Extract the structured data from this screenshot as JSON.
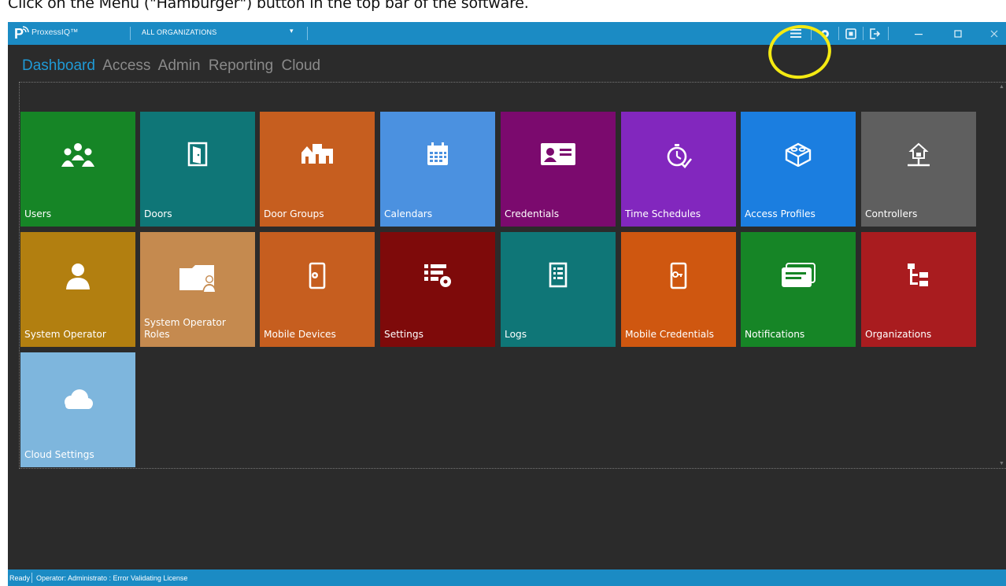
{
  "instruction": "Click on the Menu (\"Hamburger\") button in the top bar of the software.",
  "titlebar": {
    "app_name": "ProxessIQ™",
    "organization": "ALL ORGANIZATIONS",
    "buttons": [
      "hamburger-menu-icon",
      "gear-icon",
      "app-icon",
      "logout-icon",
      "minimize-icon",
      "maximize-icon",
      "close-icon"
    ]
  },
  "nav": {
    "tabs": [
      "Dashboard",
      "Access",
      "Admin",
      "Reporting",
      "Cloud"
    ],
    "active": "Dashboard"
  },
  "tiles": [
    {
      "label": "Users",
      "color": "#168526",
      "icon": "users-icon"
    },
    {
      "label": "Doors",
      "color": "#0f7677",
      "icon": "door-icon"
    },
    {
      "label": "Door Groups",
      "color": "#c65e1f",
      "icon": "door-groups-icon"
    },
    {
      "label": "Calendars",
      "color": "#4b91e0",
      "icon": "calendar-icon"
    },
    {
      "label": "Credentials",
      "color": "#7b0a6e",
      "icon": "id-card-icon"
    },
    {
      "label": "Time Schedules",
      "color": "#8227be",
      "icon": "stopwatch-icon"
    },
    {
      "label": "Access Profiles",
      "color": "#1b7ee0",
      "icon": "lego-brick-icon"
    },
    {
      "label": "Controllers",
      "color": "#5f5f5f",
      "icon": "network-home-icon"
    },
    {
      "label": "System Operator",
      "color": "#b27f10",
      "icon": "person-icon"
    },
    {
      "label": "System Operator Roles",
      "color": "#c58a4f",
      "icon": "folder-person-icon"
    },
    {
      "label": "Mobile Devices",
      "color": "#c65e1f",
      "icon": "mobile-gear-icon"
    },
    {
      "label": "Settings",
      "color": "#7e0a0a",
      "icon": "settings-list-icon"
    },
    {
      "label": "Logs",
      "color": "#0f7677",
      "icon": "log-list-icon"
    },
    {
      "label": "Mobile Credentials",
      "color": "#cf5710",
      "icon": "mobile-key-icon"
    },
    {
      "label": "Notifications",
      "color": "#168526",
      "icon": "notification-message-icon"
    },
    {
      "label": "Organizations",
      "color": "#a91c1f",
      "icon": "org-tree-icon"
    },
    {
      "label": "Cloud Settings",
      "color": "#7eb6dd",
      "icon": "cloud-icon"
    }
  ],
  "statusbar": {
    "ready": "Ready",
    "operator": "Operator: Administrato : Error Validating License"
  }
}
